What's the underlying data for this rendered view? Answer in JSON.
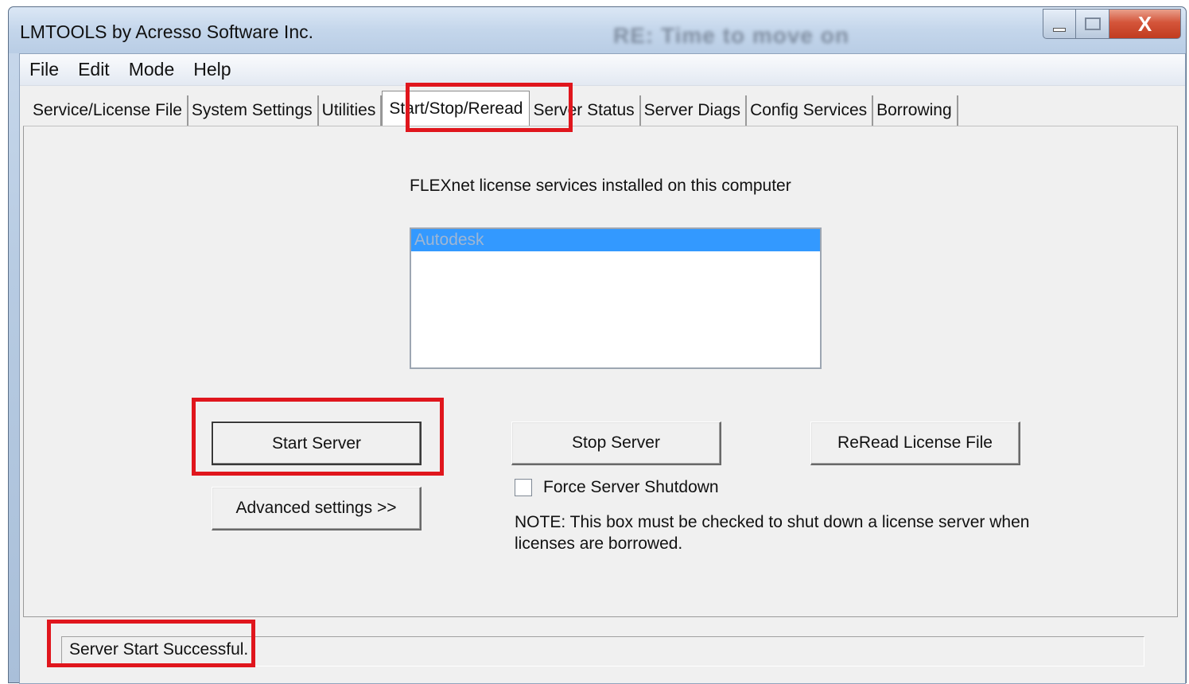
{
  "window": {
    "title": "LMTOOLS by Acresso Software Inc.",
    "background_title": "RE: Time to move on",
    "close_glyph": "X"
  },
  "menu": [
    "File",
    "Edit",
    "Mode",
    "Help"
  ],
  "tabs": [
    {
      "label": "Service/License File",
      "active": false
    },
    {
      "label": "System Settings",
      "active": false
    },
    {
      "label": "Utilities",
      "active": false
    },
    {
      "label": "Start/Stop/Reread",
      "active": true
    },
    {
      "label": "Server Status",
      "active": false
    },
    {
      "label": "Server Diags",
      "active": false
    },
    {
      "label": "Config Services",
      "active": false
    },
    {
      "label": "Borrowing",
      "active": false
    }
  ],
  "services": {
    "label": "FLEXnet license services installed on this computer",
    "items": [
      "Autodesk"
    ],
    "selected": "Autodesk"
  },
  "buttons": {
    "start": "Start Server",
    "stop": "Stop Server",
    "reread": "ReRead License File",
    "advanced": "Advanced settings >>"
  },
  "force_shutdown": {
    "label": "Force Server Shutdown",
    "checked": false
  },
  "note": "NOTE:  This box must be checked to shut down a license server when licenses are borrowed.",
  "status": "Server Start Successful.",
  "colors": {
    "highlight": "#e0161d",
    "selection": "#3399ff"
  },
  "icons": {
    "minimize": "minimize-icon",
    "maximize": "maximize-icon",
    "close": "close-icon"
  }
}
